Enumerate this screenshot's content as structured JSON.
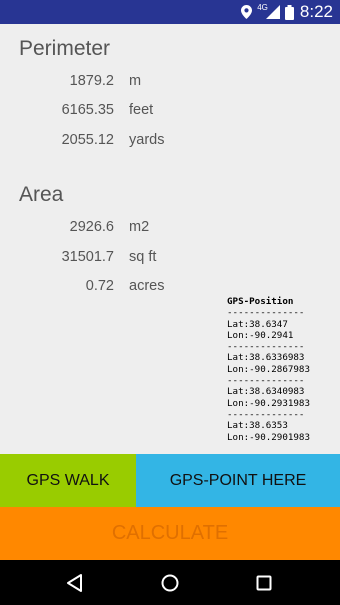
{
  "status_bar": {
    "time": "8:22",
    "network": "4G",
    "icons": [
      "location-pin-icon",
      "signal-icon",
      "battery-icon"
    ]
  },
  "perimeter": {
    "title": "Perimeter",
    "rows": [
      {
        "value": "1879.2",
        "unit": "m"
      },
      {
        "value": "6165.35",
        "unit": "feet"
      },
      {
        "value": "2055.12",
        "unit": "yards"
      }
    ]
  },
  "area": {
    "title": "Area",
    "rows": [
      {
        "value": "2926.6",
        "unit": "m2"
      },
      {
        "value": "31501.7",
        "unit": "sq ft"
      },
      {
        "value": "0.72",
        "unit": "acres"
      }
    ]
  },
  "gps_log": {
    "header": "GPS-Position",
    "separator": "--------------",
    "points": [
      {
        "lat": "Lat:38.6347",
        "lon": "Lon:-90.2941"
      },
      {
        "lat": "Lat:38.6336983",
        "lon": "Lon:-90.2867983"
      },
      {
        "lat": "Lat:38.6340983",
        "lon": "Lon:-90.2931983"
      },
      {
        "lat": "Lat:38.6353",
        "lon": "Lon:-90.2901983"
      }
    ]
  },
  "buttons": {
    "gps_walk": "GPS WALK",
    "gps_point_here": "GPS-POINT HERE",
    "calculate": "CALCULATE"
  },
  "colors": {
    "status_bar": "#283593",
    "gps_walk": "#99cc00",
    "gps_point": "#33b5e5",
    "calculate": "#ff8800",
    "calculate_text": "#e07000"
  },
  "nav_bar": {
    "icons": [
      "back-icon",
      "home-icon",
      "recents-icon"
    ]
  }
}
